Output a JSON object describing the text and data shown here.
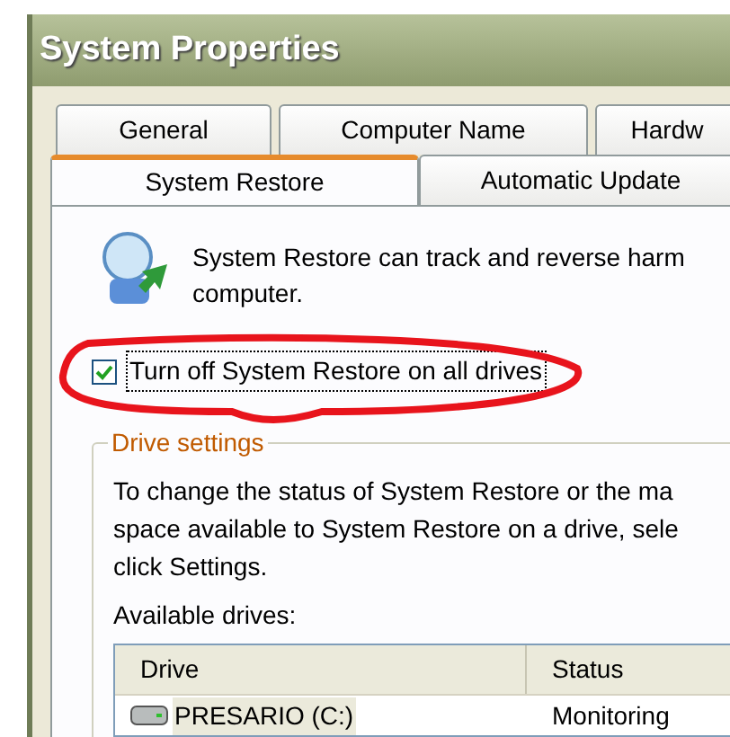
{
  "window": {
    "title": "System Properties"
  },
  "tab_rows": [
    [
      {
        "label": "General",
        "selected": false
      },
      {
        "label": "Computer Name",
        "selected": false
      },
      {
        "label": "Hardw",
        "selected": false
      }
    ],
    [
      {
        "label": "System Restore",
        "selected": true
      },
      {
        "label": "Automatic Update",
        "selected": false
      }
    ]
  ],
  "description": [
    "System Restore can track and reverse harm",
    "computer."
  ],
  "turn_off": {
    "label": "Turn off System Restore on all drives",
    "checked": true
  },
  "drive_settings": {
    "title": "Drive settings",
    "text": [
      "To change the status of System Restore or the ma",
      "space available to System Restore on a drive, sele",
      "click Settings."
    ],
    "available_label": "Available drives:",
    "columns": [
      "Drive",
      "Status"
    ],
    "rows": [
      {
        "drive": "PRESARIO (C:)",
        "status": "Monitoring",
        "selected": true
      }
    ]
  }
}
